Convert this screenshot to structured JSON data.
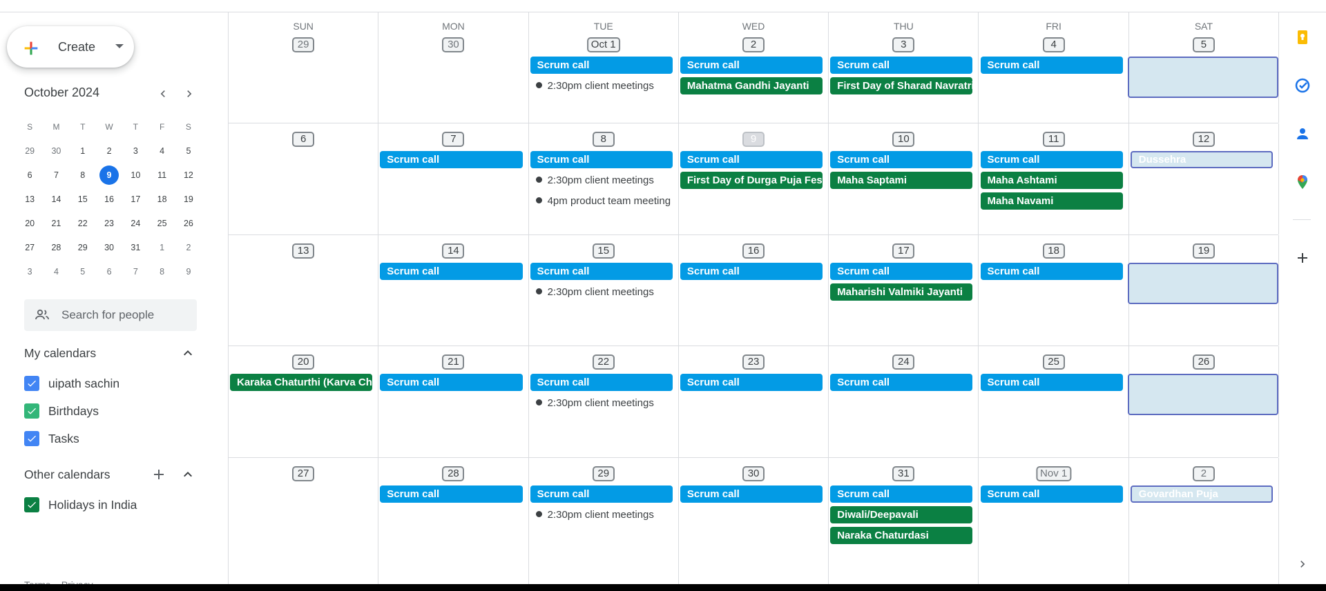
{
  "sidebar": {
    "create_label": "Create",
    "mini_calendar": {
      "title": "October 2024",
      "weekday_initials": [
        "S",
        "M",
        "T",
        "W",
        "T",
        "F",
        "S"
      ],
      "weeks": [
        [
          "29",
          "30",
          "1",
          "2",
          "3",
          "4",
          "5"
        ],
        [
          "6",
          "7",
          "8",
          "9",
          "10",
          "11",
          "12"
        ],
        [
          "13",
          "14",
          "15",
          "16",
          "17",
          "18",
          "19"
        ],
        [
          "20",
          "21",
          "22",
          "23",
          "24",
          "25",
          "26"
        ],
        [
          "27",
          "28",
          "29",
          "30",
          "31",
          "1",
          "2"
        ],
        [
          "3",
          "4",
          "5",
          "6",
          "7",
          "8",
          "9"
        ]
      ],
      "today": "9"
    },
    "search_placeholder": "Search for people",
    "my_calendars": {
      "title": "My calendars",
      "items": [
        {
          "label": "uipath sachin",
          "color": "#4285f4"
        },
        {
          "label": "Birthdays",
          "color": "#33b679"
        },
        {
          "label": "Tasks",
          "color": "#4285f4"
        }
      ]
    },
    "other_calendars": {
      "title": "Other calendars",
      "items": [
        {
          "label": "Holidays in India",
          "color": "#0b8043"
        }
      ]
    },
    "footer": {
      "terms": "Terms",
      "separator": "–",
      "privacy": "Privacy"
    }
  },
  "calendar": {
    "weekdays": [
      "SUN",
      "MON",
      "TUE",
      "WED",
      "THU",
      "FRI",
      "SAT"
    ],
    "weeks": [
      {
        "days": [
          {
            "num": "29",
            "dim": true,
            "events": []
          },
          {
            "num": "30",
            "dim": true,
            "events": []
          },
          {
            "num": "Oct 1",
            "events": [
              {
                "kind": "allday",
                "color": "blue",
                "title": "Scrum call"
              },
              {
                "kind": "timed",
                "time": "2:30pm",
                "title": "client meetings"
              }
            ]
          },
          {
            "num": "2",
            "events": [
              {
                "kind": "allday",
                "color": "blue",
                "title": "Scrum call"
              },
              {
                "kind": "allday",
                "color": "green",
                "title": "Mahatma Gandhi Jayanti"
              }
            ]
          },
          {
            "num": "3",
            "events": [
              {
                "kind": "allday",
                "color": "blue",
                "title": "Scrum call"
              },
              {
                "kind": "allday",
                "color": "green",
                "title": "First Day of Sharad Navratri"
              }
            ]
          },
          {
            "num": "4",
            "events": [
              {
                "kind": "allday",
                "color": "blue",
                "title": "Scrum call"
              }
            ]
          },
          {
            "num": "5",
            "events": [
              {
                "kind": "block",
                "title": ""
              }
            ]
          }
        ]
      },
      {
        "days": [
          {
            "num": "6",
            "events": []
          },
          {
            "num": "7",
            "events": [
              {
                "kind": "allday",
                "color": "blue",
                "title": "Scrum call"
              }
            ]
          },
          {
            "num": "8",
            "events": [
              {
                "kind": "allday",
                "color": "blue",
                "title": "Scrum call"
              },
              {
                "kind": "timed",
                "time": "2:30pm",
                "title": "client meetings"
              },
              {
                "kind": "timed",
                "time": "4pm",
                "title": "product team meeting"
              }
            ]
          },
          {
            "num": "9",
            "today": true,
            "events": [
              {
                "kind": "allday",
                "color": "blue",
                "title": "Scrum call"
              },
              {
                "kind": "allday",
                "color": "green",
                "title": "First Day of Durga Puja Festivities"
              }
            ]
          },
          {
            "num": "10",
            "events": [
              {
                "kind": "allday",
                "color": "blue",
                "title": "Scrum call"
              },
              {
                "kind": "allday",
                "color": "green",
                "title": "Maha Saptami"
              }
            ]
          },
          {
            "num": "11",
            "events": [
              {
                "kind": "allday",
                "color": "blue",
                "title": "Scrum call"
              },
              {
                "kind": "allday",
                "color": "green",
                "title": "Maha Ashtami"
              },
              {
                "kind": "allday",
                "color": "green",
                "title": "Maha Navami"
              }
            ]
          },
          {
            "num": "12",
            "events": [
              {
                "kind": "allday",
                "color": "pale",
                "title": "Dussehra"
              }
            ]
          }
        ]
      },
      {
        "days": [
          {
            "num": "13",
            "events": []
          },
          {
            "num": "14",
            "events": [
              {
                "kind": "allday",
                "color": "blue",
                "title": "Scrum call"
              }
            ]
          },
          {
            "num": "15",
            "events": [
              {
                "kind": "allday",
                "color": "blue",
                "title": "Scrum call"
              },
              {
                "kind": "timed",
                "time": "2:30pm",
                "title": "client meetings"
              }
            ]
          },
          {
            "num": "16",
            "events": [
              {
                "kind": "allday",
                "color": "blue",
                "title": "Scrum call"
              }
            ]
          },
          {
            "num": "17",
            "events": [
              {
                "kind": "allday",
                "color": "blue",
                "title": "Scrum call"
              },
              {
                "kind": "allday",
                "color": "green",
                "title": "Maharishi Valmiki Jayanti"
              }
            ]
          },
          {
            "num": "18",
            "events": [
              {
                "kind": "allday",
                "color": "blue",
                "title": "Scrum call"
              }
            ]
          },
          {
            "num": "19",
            "events": [
              {
                "kind": "block",
                "title": ""
              }
            ]
          }
        ]
      },
      {
        "days": [
          {
            "num": "20",
            "events": [
              {
                "kind": "allday",
                "color": "green",
                "title": "Karaka Chaturthi (Karva Chauth)"
              }
            ]
          },
          {
            "num": "21",
            "events": [
              {
                "kind": "allday",
                "color": "blue",
                "title": "Scrum call"
              }
            ]
          },
          {
            "num": "22",
            "events": [
              {
                "kind": "allday",
                "color": "blue",
                "title": "Scrum call"
              },
              {
                "kind": "timed",
                "time": "2:30pm",
                "title": "client meetings"
              }
            ]
          },
          {
            "num": "23",
            "events": [
              {
                "kind": "allday",
                "color": "blue",
                "title": "Scrum call"
              }
            ]
          },
          {
            "num": "24",
            "events": [
              {
                "kind": "allday",
                "color": "blue",
                "title": "Scrum call"
              }
            ]
          },
          {
            "num": "25",
            "events": [
              {
                "kind": "allday",
                "color": "blue",
                "title": "Scrum call"
              }
            ]
          },
          {
            "num": "26",
            "events": [
              {
                "kind": "block",
                "title": ""
              }
            ]
          }
        ]
      },
      {
        "days": [
          {
            "num": "27",
            "events": []
          },
          {
            "num": "28",
            "events": [
              {
                "kind": "allday",
                "color": "blue",
                "title": "Scrum call"
              }
            ]
          },
          {
            "num": "29",
            "events": [
              {
                "kind": "allday",
                "color": "blue",
                "title": "Scrum call"
              },
              {
                "kind": "timed",
                "time": "2:30pm",
                "title": "client meetings"
              }
            ]
          },
          {
            "num": "30",
            "events": [
              {
                "kind": "allday",
                "color": "blue",
                "title": "Scrum call"
              }
            ]
          },
          {
            "num": "31",
            "events": [
              {
                "kind": "allday",
                "color": "blue",
                "title": "Scrum call"
              },
              {
                "kind": "allday",
                "color": "green",
                "title": "Diwali/Deepavali"
              },
              {
                "kind": "allday",
                "color": "green",
                "title": "Naraka Chaturdasi"
              }
            ]
          },
          {
            "num": "Nov 1",
            "dim": true,
            "events": [
              {
                "kind": "allday",
                "color": "blue",
                "title": "Scrum call"
              }
            ]
          },
          {
            "num": "2",
            "dim": true,
            "events": [
              {
                "kind": "allday",
                "color": "pale",
                "title": "Govardhan Puja"
              }
            ]
          }
        ]
      }
    ]
  },
  "rail": {
    "icons": [
      "keep-icon",
      "tasks-icon",
      "contacts-icon",
      "maps-icon",
      "add-addon-icon",
      "expand-panel-icon"
    ]
  },
  "colors": {
    "event_blue": "#039be5",
    "holiday_green": "#0b8043",
    "today_blue": "#1a73e8"
  }
}
